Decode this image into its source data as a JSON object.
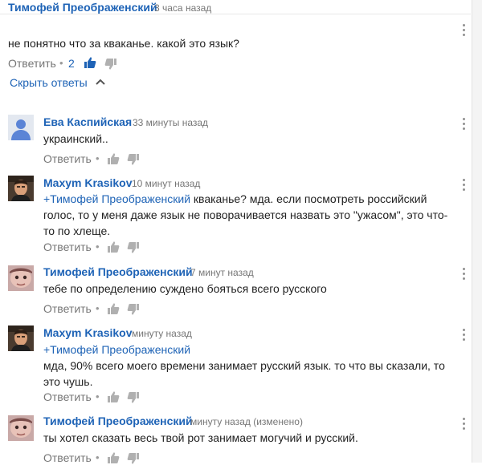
{
  "comments": [
    {
      "author": "Тимофей Преображенский",
      "time": "3 часа назад",
      "text": "не понятно что за кваканье. какой это язык?",
      "reply": "Ответить",
      "likes": "2"
    },
    {
      "author": "Ева Каспийская",
      "time": "33 минуты назад",
      "text": "украинский..",
      "reply": "Ответить"
    },
    {
      "author": "Maxym Krasikov",
      "time": "10 минут назад",
      "mention": "+Тимофей Преображенский",
      "text_line1": " кваканье? мда. если посмотреть российский",
      "text_line2": "голос, то у меня даже язык не поворачивается назвать это \"ужасом\", это что-",
      "text_line3": "то по хлеще.",
      "reply": "Ответить"
    },
    {
      "author": "Тимофей Преображенский",
      "time": "7 минут назад",
      "text": "тебе по определению суждено бояться всего русского",
      "reply": "Ответить"
    },
    {
      "author": "Maxym Krasikov",
      "time": "минуту назад",
      "mention": "+Тимофей Преображенский",
      "text_line1": "мда, 90% всего моего времени занимает русский язык. то что вы сказали, то",
      "text_line2": "это чушь.",
      "reply": "Ответить"
    },
    {
      "author": "Тимофей Преображенский",
      "time": "минуту назад (изменено)",
      "text": "ты хотел сказать весь твой рот занимает могучий и русский.",
      "reply": "Ответить"
    }
  ],
  "hide_replies": "Скрыть ответы",
  "separator": "•",
  "colors": {
    "link": "#1e63b6",
    "like_active": "#1e63b6",
    "icon": "#b0b0b0"
  },
  "icons": {
    "like": "thumbs-up-icon",
    "dislike": "thumbs-down-icon",
    "menu": "more-vertical-icon",
    "collapse": "chevron-up-icon"
  }
}
